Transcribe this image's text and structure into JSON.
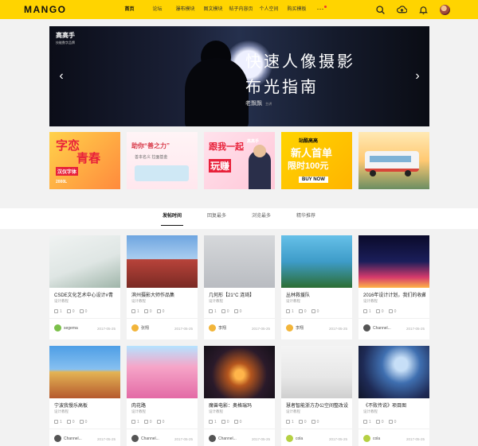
{
  "header": {
    "logo": "MANGO",
    "nav": [
      "首页",
      "论坛",
      "瀑布模块",
      "图文模块",
      "帖子内容页",
      "个人空间",
      "购买模板"
    ],
    "more": "···",
    "icons": [
      "search-icon",
      "upload-icon",
      "bell-icon",
      "user-avatar"
    ]
  },
  "hero": {
    "brand_name": "高高手",
    "brand_sub": "技能数字品牌",
    "title_line1": "快速人像摄影",
    "title_line2": "布光指南",
    "author": "老飘飘",
    "author_role": "主讲",
    "prev_label": "‹",
    "next_label": "›"
  },
  "promos": [
    {
      "line1": "字恋",
      "line2": "青春",
      "line3": "汉仪字体",
      "line4": "2000L"
    },
    {
      "line1": "助你“善之力”",
      "line2": "善本名义 拉面基金"
    },
    {
      "line1": "跟我一起",
      "line2": "玩赚",
      "line3": "高高手"
    },
    {
      "line1": "站酷高高",
      "line2": "新人首单",
      "line3": "限时100元",
      "line4": "BUY NOW"
    },
    {
      "line1": ""
    }
  ],
  "tabs": [
    "发帖时间",
    "回复最多",
    "浏览最多",
    "精华推荐"
  ],
  "cards": [
    {
      "title": "CSDE文化艺术中心设计#青",
      "cat": "设计教程",
      "views": "1",
      "comments": "0",
      "likes": "0",
      "user": "segema",
      "date": "2017-05-25"
    },
    {
      "title": "滨州摄影大师作品集",
      "cat": "设计教程",
      "views": "1",
      "comments": "0",
      "likes": "0",
      "user": "张翔",
      "date": "2017-05-25"
    },
    {
      "title": "几何形【21°C 涟琦】",
      "cat": "设计教程",
      "views": "1",
      "comments": "0",
      "likes": "0",
      "user": "李翔",
      "date": "2017-05-25"
    },
    {
      "title": "丛林救援队",
      "cat": "设计教程",
      "views": "1",
      "comments": "0",
      "likes": "0",
      "user": "李翔",
      "date": "2017-05-25"
    },
    {
      "title": "2016年设计计划，我们的收藏",
      "cat": "设计教程",
      "views": "1",
      "comments": "0",
      "likes": "0",
      "user": "Channel...",
      "date": "2017-05-25"
    },
    {
      "title": "宁波我慢乐高板",
      "cat": "设计教程",
      "views": "1",
      "comments": "0",
      "likes": "0",
      "user": "Channel...",
      "date": "2017-05-25"
    },
    {
      "title": "肉花路",
      "cat": "设计教程",
      "views": "1",
      "comments": "0",
      "likes": "0",
      "user": "Channel...",
      "date": "2017-05-25"
    },
    {
      "title": "魔兽电影：奥格瑞玛",
      "cat": "设计教程",
      "views": "1",
      "comments": "0",
      "likes": "0",
      "user": "Channel...",
      "date": "2017-05-25"
    },
    {
      "title": "慧者智能浙方办公空间整改设",
      "cat": "设计教程",
      "views": "1",
      "comments": "0",
      "likes": "0",
      "user": "cola",
      "date": "2017-05-25"
    },
    {
      "title": "《不败传说》项目图",
      "cat": "设计教程",
      "views": "1",
      "comments": "0",
      "likes": "0",
      "user": "cola",
      "date": "2017-05-25"
    }
  ],
  "colors": {
    "accent": "#ffd400",
    "background": "#f2f2f2"
  }
}
